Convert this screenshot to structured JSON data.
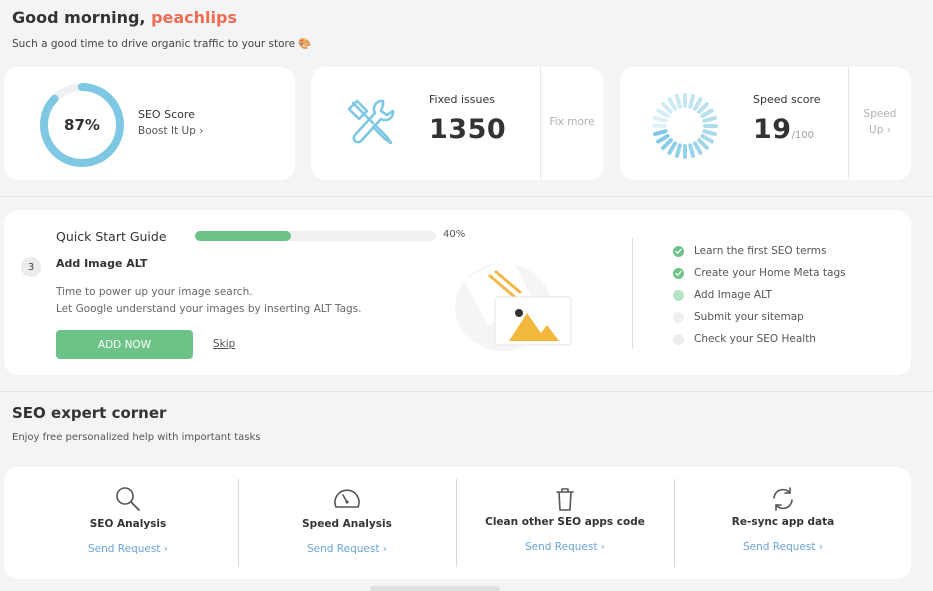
{
  "header": {
    "greeting": "Good morning,",
    "username": "peachlips",
    "subtitle": "Such a good time to drive organic traffic to your store",
    "subtitle_emoji": "🎨"
  },
  "stats": {
    "seo": {
      "value_label": "87%",
      "progress_percent": 87,
      "label": "SEO Score",
      "link": "Boost It Up ›",
      "icon": "progress-ring-icon",
      "accent": "#7ec8e3"
    },
    "fixed": {
      "label": "Fixed issues",
      "value": "1350",
      "side_link": "Fix more",
      "icon": "wrench-screwdriver-icon",
      "accent": "#7ec8e3"
    },
    "speed": {
      "label": "Speed score",
      "value": "19",
      "unit": "/100",
      "side_link_line1": "Speed",
      "side_link_line2": "Up ›",
      "icon": "loading-spinner-icon"
    }
  },
  "quick_start": {
    "title": "Quick Start Guide",
    "progress_percent": 40,
    "progress_label": "40%",
    "step_number": "3",
    "step_title": "Add Image ALT",
    "desc_line1": "Time to power up your image search.",
    "desc_line2": "Let Google understand your images by inserting ALT Tags.",
    "button_label": "ADD NOW",
    "skip_label": "Skip",
    "illustration": "image-alt-illustration",
    "checklist": [
      {
        "label": "Learn the first SEO terms",
        "state": "done"
      },
      {
        "label": "Create your Home Meta tags",
        "state": "done"
      },
      {
        "label": "Add Image ALT",
        "state": "current"
      },
      {
        "label": "Submit your sitemap",
        "state": "todo"
      },
      {
        "label": "Check your SEO Health",
        "state": "todo"
      }
    ],
    "accent": "#6cc287"
  },
  "expert": {
    "title": "SEO expert corner",
    "subtitle": "Enjoy free personalized help with important tasks",
    "items": [
      {
        "title": "SEO Analysis",
        "link": "Send Request ›",
        "icon": "search-icon"
      },
      {
        "title": "Speed Analysis",
        "link": "Send Request ›",
        "icon": "speedometer-icon"
      },
      {
        "title": "Clean other SEO apps code",
        "link": "Send Request ›",
        "icon": "trash-icon"
      },
      {
        "title": "Re-sync app data",
        "link": "Send Request ›",
        "icon": "sync-icon"
      }
    ],
    "link_color": "#6aa5d9"
  }
}
